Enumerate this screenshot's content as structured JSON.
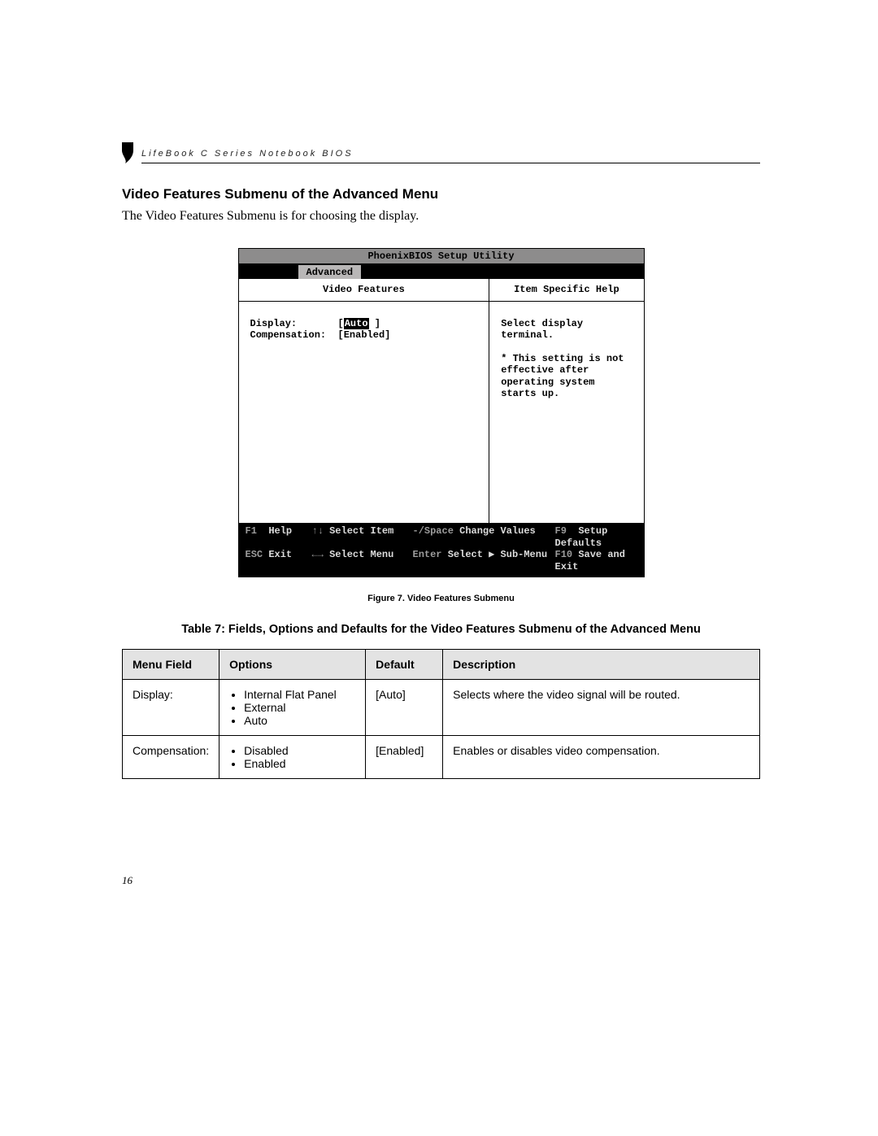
{
  "header": {
    "running_head": "LifeBook C Series Notebook BIOS"
  },
  "section": {
    "title": "Video Features Submenu of the Advanced Menu",
    "intro": "The Video Features Submenu is for choosing the display."
  },
  "bios": {
    "title": "PhoenixBIOS Setup Utility",
    "active_tab": "Advanced",
    "left_pane_title": "Video Features",
    "right_pane_title": "Item Specific Help",
    "fields": {
      "display_label": "Display:",
      "display_value": "Auto",
      "comp_label": "Compensation:",
      "comp_value": "[Enabled]"
    },
    "help_text": "Select display terminal.\n\n* This setting is not effective after operating system starts up.",
    "footer": {
      "f1": "F1",
      "help": "Help",
      "esc": "ESC",
      "exit": "Exit",
      "updown": "↑↓",
      "select_item": "Select Item",
      "leftright": "←→",
      "select_menu": "Select Menu",
      "minus_space": "-/Space",
      "change_values": "Change Values",
      "enter": "Enter",
      "select_sub": "Select ▶ Sub-Menu",
      "f9": "F9",
      "setup_defaults": "Setup Defaults",
      "f10": "F10",
      "save_exit": "Save and Exit"
    }
  },
  "figure_caption": "Figure 7.  Video Features Submenu",
  "table_caption": "Table 7: Fields, Options and Defaults for the Video Features Submenu of the Advanced Menu",
  "table": {
    "headers": {
      "menu_field": "Menu Field",
      "options": "Options",
      "default": "Default",
      "description": "Description"
    },
    "rows": [
      {
        "menu_field": "Display:",
        "options": [
          "Internal Flat Panel",
          "External",
          "Auto"
        ],
        "default": "[Auto]",
        "description": "Selects where the video signal will be routed."
      },
      {
        "menu_field": "Compensation:",
        "options": [
          "Disabled",
          "Enabled"
        ],
        "default": "[Enabled]",
        "description": "Enables or disables video compensation."
      }
    ]
  },
  "page_number": "16"
}
